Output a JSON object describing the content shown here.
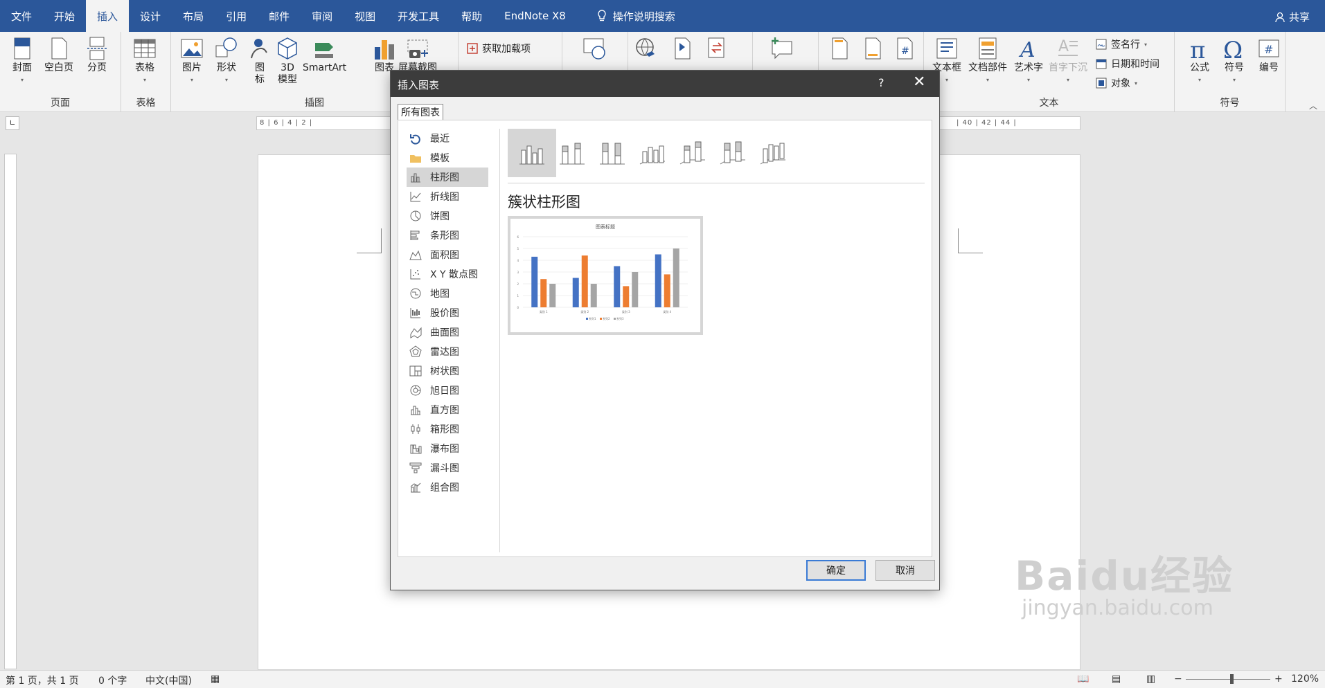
{
  "tabs": [
    "文件",
    "开始",
    "插入",
    "设计",
    "布局",
    "引用",
    "邮件",
    "审阅",
    "视图",
    "开发工具",
    "帮助",
    "EndNote X8"
  ],
  "active_tab": "插入",
  "search_tab": "操作说明搜索",
  "share_label": "共享",
  "ribbon": {
    "pages": {
      "cover": "封面",
      "blank": "空白页",
      "break": "分页",
      "label": "页面"
    },
    "tables": {
      "table": "表格",
      "label": "表格"
    },
    "illustrations": {
      "pictures": "图片",
      "shapes": "形状",
      "icons_top": "图",
      "icons_bottom": "标",
      "model_top": "3D",
      "model_bottom": "模型",
      "smartart": "SmartArt",
      "chart": "图表",
      "screenshot": "屏幕截图",
      "label": "插图"
    },
    "addins": {
      "get": "获取加载项"
    },
    "text": {
      "textbox": "文本框",
      "quickparts": "文档部件",
      "wordart": "艺术字",
      "dropcap": "首字下沉",
      "signature": "签名行",
      "datetime": "日期和时间",
      "object": "对象",
      "label": "文本"
    },
    "symbols": {
      "equation": "公式",
      "symbol": "符号",
      "number": "编号",
      "label": "符号"
    }
  },
  "ruler_text": "8 | 6 | 4 | 2 |",
  "ruler_text_right": "| 40 | 42 | 44 |",
  "dialog": {
    "title": "插入图表",
    "help": "?",
    "tab": "所有图表",
    "categories": [
      "最近",
      "模板",
      "柱形图",
      "折线图",
      "饼图",
      "条形图",
      "面积图",
      "X Y 散点图",
      "地图",
      "股价图",
      "曲面图",
      "雷达图",
      "树状图",
      "旭日图",
      "直方图",
      "箱形图",
      "瀑布图",
      "漏斗图",
      "组合图"
    ],
    "selected_category": "柱形图",
    "chart_name": "簇状柱形图",
    "ok": "确定",
    "cancel": "取消"
  },
  "chart_data": {
    "type": "bar",
    "title": "图表标题",
    "categories": [
      "类别 1",
      "类别 2",
      "类别 3",
      "类别 4"
    ],
    "series": [
      {
        "name": "系列1",
        "color": "#4472c4",
        "values": [
          4.3,
          2.5,
          3.5,
          4.5
        ]
      },
      {
        "name": "系列2",
        "color": "#ed7d31",
        "values": [
          2.4,
          4.4,
          1.8,
          2.8
        ]
      },
      {
        "name": "系列3",
        "color": "#a5a5a5",
        "values": [
          2.0,
          2.0,
          3.0,
          5.0
        ]
      }
    ],
    "ylim": [
      0,
      6
    ],
    "yticks": [
      "0",
      "1",
      "2",
      "3",
      "4",
      "5",
      "6"
    ]
  },
  "status": {
    "page": "第 1 页，共 1 页",
    "words": "0 个字",
    "lang": "中文(中国)",
    "zoom": "120%"
  },
  "watermark": {
    "brand": "Baidu经验",
    "url": "jingyan.baidu.com"
  }
}
